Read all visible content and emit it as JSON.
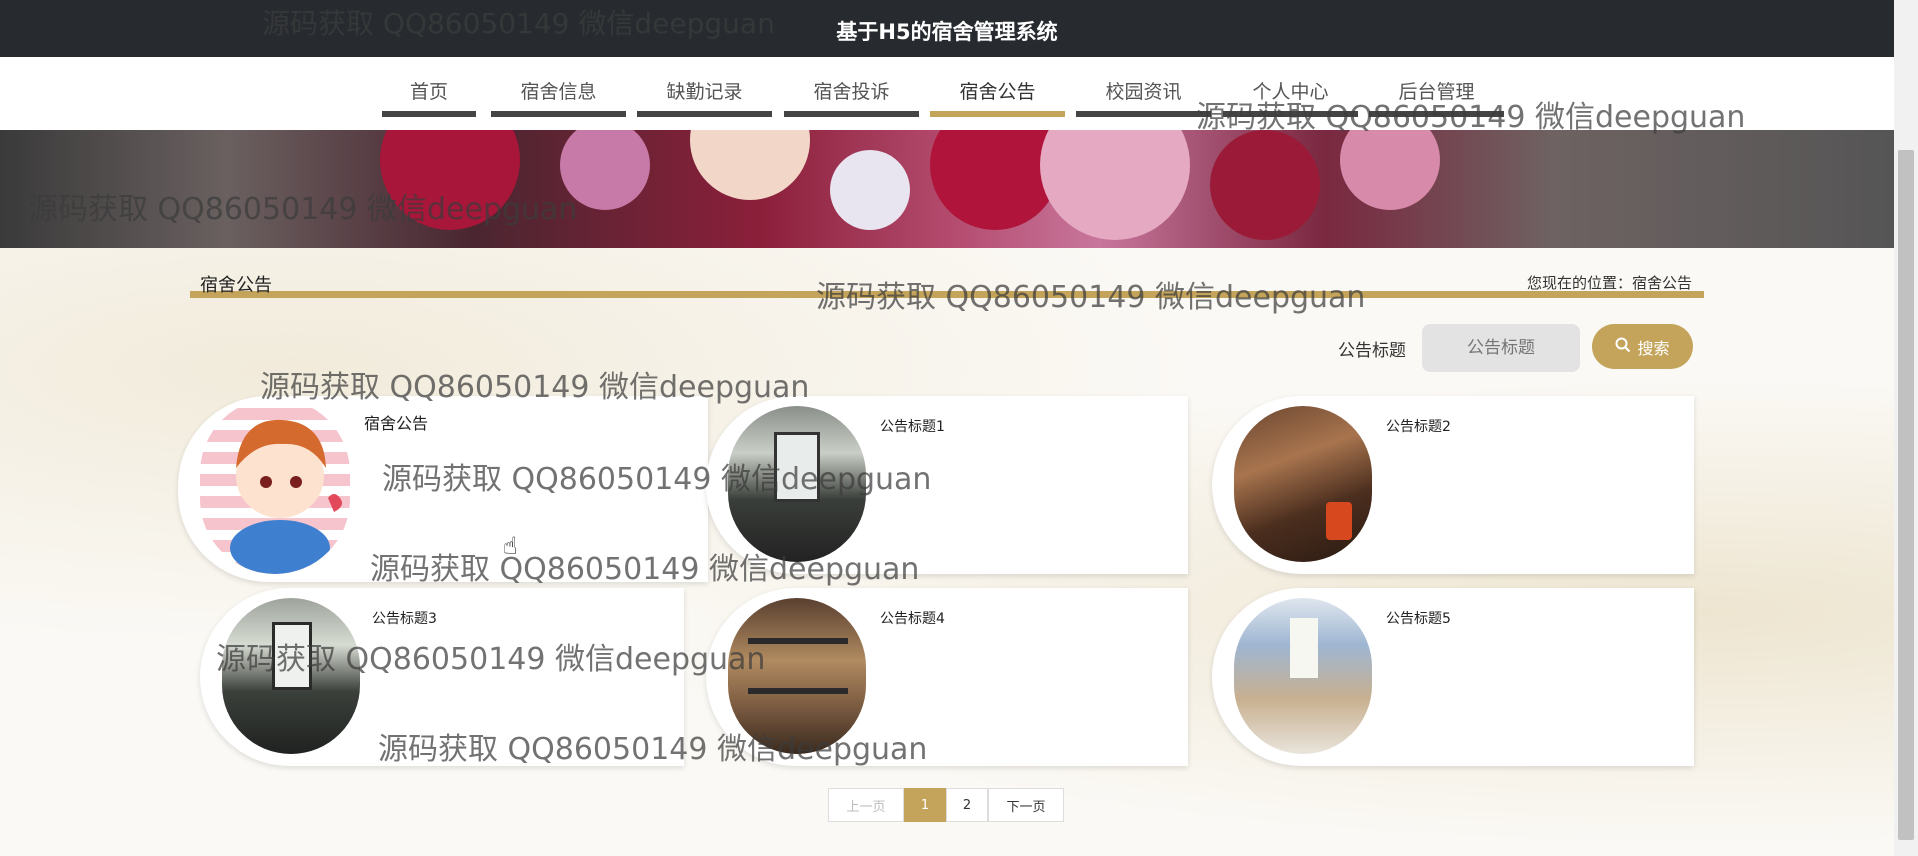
{
  "header": {
    "title": "基于H5的宿舍管理系统"
  },
  "nav": {
    "items": [
      "首页",
      "宿舍信息",
      "缺勤记录",
      "宿舍投诉",
      "宿舍公告",
      "校园资讯",
      "个人中心",
      "后台管理"
    ],
    "active": "宿舍公告"
  },
  "section": {
    "title": "宿舍公告",
    "breadcrumb": "您现在的位置：宿舍公告"
  },
  "search": {
    "label": "公告标题",
    "placeholder": "公告标题",
    "button": "搜索"
  },
  "cards": [
    {
      "label": "宿舍公告"
    },
    {
      "label": "公告标题1"
    },
    {
      "label": "公告标题2"
    },
    {
      "label": "公告标题3"
    },
    {
      "label": "公告标题4"
    },
    {
      "label": "公告标题5"
    }
  ],
  "pagination": {
    "prev": "上一页",
    "pages": [
      "1",
      "2"
    ],
    "current": "1",
    "next": "下一页"
  },
  "watermark": "源码获取 QQ86050149 微信deepguan",
  "colors": {
    "accent": "#c4a45b",
    "header_bg": "#272b30"
  }
}
